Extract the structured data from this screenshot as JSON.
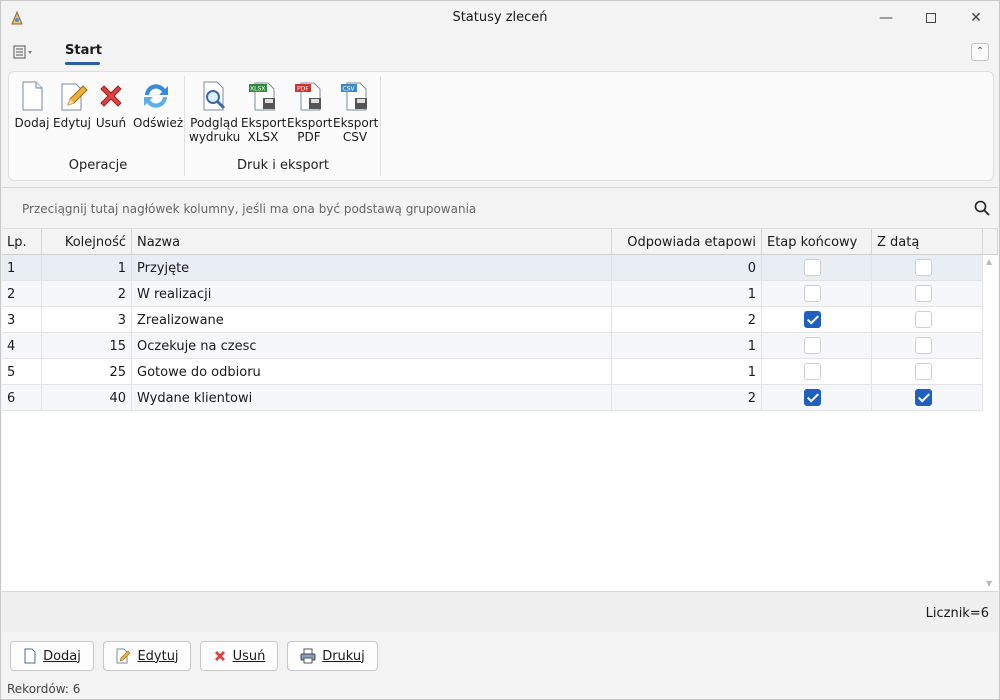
{
  "window": {
    "title": "Statusy zleceń"
  },
  "ribbon": {
    "tab": "Start",
    "groups": [
      {
        "label": "Operacje"
      },
      {
        "label": "Druk i eksport"
      }
    ],
    "buttons": {
      "dodaj": "Dodaj",
      "edytuj": "Edytuj",
      "usun": "Usuń",
      "odswiez": "Odśwież",
      "podglad_1": "Podgląd",
      "podglad_2": "wydruku",
      "xlsx_1": "Eksport",
      "xlsx_2": "XLSX",
      "pdf_1": "Eksport",
      "pdf_2": "PDF",
      "csv_1": "Eksport",
      "csv_2": "CSV"
    }
  },
  "grid": {
    "group_hint": "Przeciągnij tutaj nagłówek kolumny, jeśli ma ona być podstawą grupowania",
    "columns": [
      "Lp.",
      "Kolejność",
      "Nazwa",
      "Odpowiada etapowi",
      "Etap końcowy",
      "Z datą"
    ],
    "rows": [
      {
        "lp": "1",
        "kol": "1",
        "nazwa": "Przyjęte",
        "etap": "0",
        "koncowy": false,
        "zdata": false
      },
      {
        "lp": "2",
        "kol": "2",
        "nazwa": "W realizacji",
        "etap": "1",
        "koncowy": false,
        "zdata": false
      },
      {
        "lp": "3",
        "kol": "3",
        "nazwa": "Zrealizowane",
        "etap": "2",
        "koncowy": true,
        "zdata": false
      },
      {
        "lp": "4",
        "kol": "15",
        "nazwa": "Oczekuje na czesc",
        "etap": "1",
        "koncowy": false,
        "zdata": false
      },
      {
        "lp": "5",
        "kol": "25",
        "nazwa": "Gotowe do odbioru",
        "etap": "1",
        "koncowy": false,
        "zdata": false
      },
      {
        "lp": "6",
        "kol": "40",
        "nazwa": "Wydane klientowi",
        "etap": "2",
        "koncowy": true,
        "zdata": true
      }
    ],
    "counter": "Licznik=6"
  },
  "bottom_buttons": {
    "dodaj": "Dodaj",
    "edytuj": "Edytuj",
    "usun": "Usuń",
    "drukuj": "Drukuj"
  },
  "status": "Rekordów: 6",
  "colors": {
    "accent": "#1e5fbf",
    "selected_row": "#e9edf4",
    "alt_row": "#f5f7fb"
  }
}
